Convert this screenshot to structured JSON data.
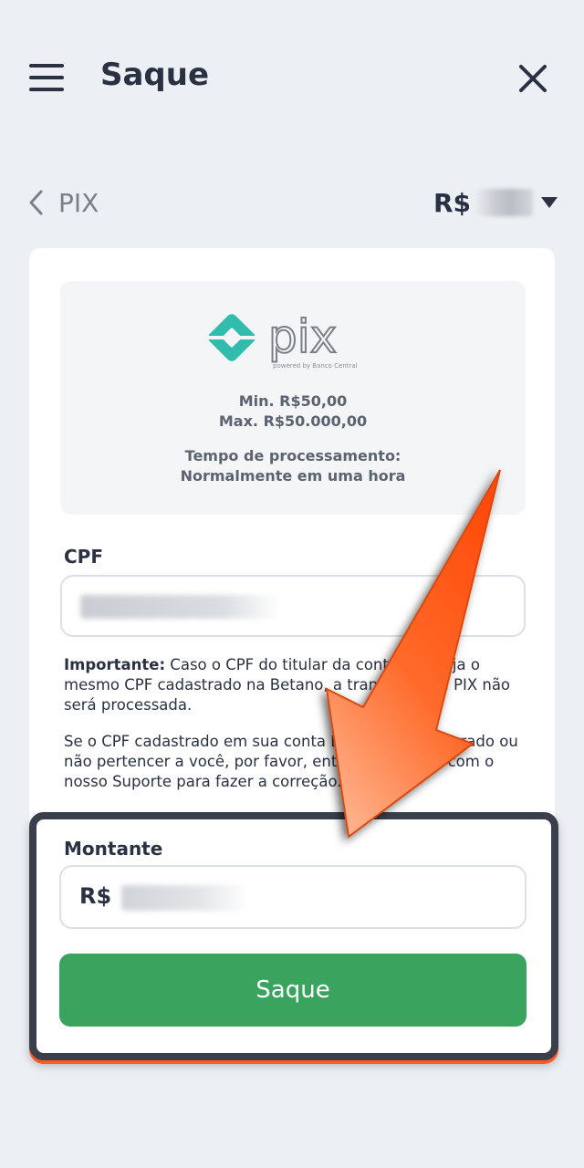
{
  "header": {
    "title": "Saque",
    "menu_icon": "hamburger-menu-icon",
    "close_icon": "close-icon"
  },
  "subnav": {
    "back_label": "PIX",
    "back_icon": "chevron-left-icon",
    "balance_currency": "R$",
    "balance_dropdown_icon": "caret-down-icon"
  },
  "pix_info": {
    "logo_text": "pix",
    "logo_tagline": "powered by Banco Central",
    "min": "Min. R$50,00",
    "max": "Max. R$50.000,00",
    "processing_title": "Tempo de processamento:",
    "processing_value": "Normalmente em uma hora"
  },
  "cpf": {
    "label": "CPF",
    "notice_bold": "Importante:",
    "notice_text": " Caso o CPF do titular da conta não seja o mesmo CPF cadastrado na Betano, a transação via PIX não será processada.",
    "notice2": "Se o CPF cadastrado em sua conta Betano estiver errado ou não pertencer a você, por favor, entre em contato com o nosso Suporte para fazer a correção."
  },
  "amount": {
    "label": "Montante",
    "prefix": "R$"
  },
  "submit": {
    "label": "Saque"
  },
  "colors": {
    "background": "#eceff3",
    "primary_text": "#2a3142",
    "button_green": "#3aa35e",
    "pix_teal": "#32bcad",
    "annotation_arrow": "#ff5a1f"
  }
}
